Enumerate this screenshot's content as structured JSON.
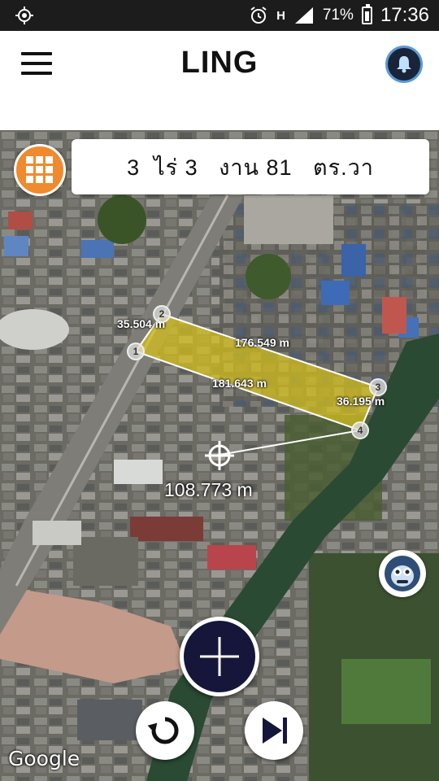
{
  "status_bar": {
    "battery": "71%",
    "time": "17:36",
    "icons": [
      "gps-icon",
      "alarm-icon",
      "data-arrows-icon",
      "signal-icon",
      "battery-icon"
    ],
    "network_label": "H"
  },
  "header": {
    "title": "LING",
    "menu_icon": "hamburger-menu-icon",
    "right_icon": "bell-icon"
  },
  "map": {
    "area_text": "3  ไร่ 3   งาน 81   ตร.วา",
    "polygon_color": "#d7c21a",
    "vertices": [
      "1",
      "2",
      "3",
      "4"
    ],
    "edge_distances": {
      "edge_1_2": "35.504 m",
      "edge_2_3": "176.549 m",
      "edge_3_4": "36.195 m",
      "edge_4_1": "181.643 m"
    },
    "cursor_distance": "108.773 m",
    "attribution": "Google"
  },
  "controls": {
    "grid_icon": "grid-menu-icon",
    "add_icon": "plus-icon",
    "undo_icon": "undo-icon",
    "next_icon": "skip-next-icon",
    "assistant_icon": "monkey-icon"
  },
  "colors": {
    "accent_orange": "#f08a2e",
    "add_button": "#15163a",
    "bell_ring": "#5a9ad6"
  }
}
